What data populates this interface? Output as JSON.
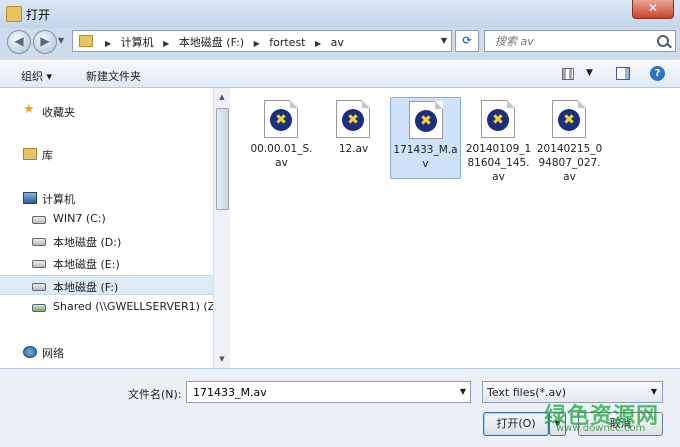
{
  "window": {
    "title": "打开",
    "close_label": "✕"
  },
  "nav": {
    "breadcrumbs": [
      "计算机",
      "本地磁盘 (F:)",
      "fortest",
      "av"
    ],
    "search_placeholder": "搜索 av"
  },
  "toolbar": {
    "organize": "组织 ▾",
    "new_folder": "新建文件夹"
  },
  "sidebar": {
    "favorites": "收藏夹",
    "libraries": "库",
    "computer": "计算机",
    "drives": [
      {
        "label": "WIN7 (C:)"
      },
      {
        "label": "本地磁盘 (D:)"
      },
      {
        "label": "本地磁盘 (E:)"
      },
      {
        "label": "本地磁盘 (F:)",
        "selected": true
      },
      {
        "label": "Shared (\\\\GWELLSERVER1) (Z"
      }
    ],
    "network": "网络"
  },
  "files": [
    {
      "name": "00.00.01_S.av"
    },
    {
      "name": "12.av"
    },
    {
      "name": "171433_M.av",
      "selected": true
    },
    {
      "name": "20140109_181604_145.av"
    },
    {
      "name": "20140215_094807_027.av"
    }
  ],
  "bottom": {
    "filename_label": "文件名(N):",
    "filename_value": "171433_M.av",
    "filetype": "Text files(*.av)",
    "open_button": "打开(O)",
    "cancel_button": "取消"
  },
  "watermark": {
    "text": "绿色资源网",
    "url": "www.downcc.com"
  },
  "colors": {
    "selection": "#cfe2f7",
    "accent": "#3a6fb4"
  }
}
